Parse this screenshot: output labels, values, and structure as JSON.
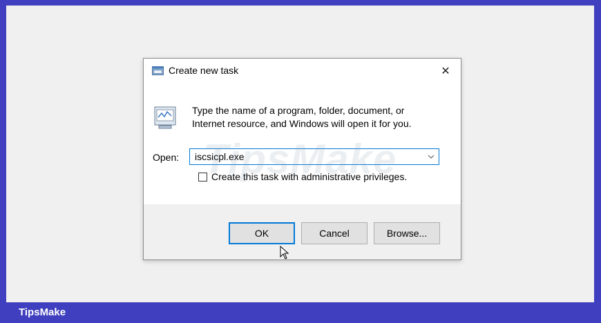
{
  "dialog": {
    "title": "Create new task",
    "close_glyph": "✕",
    "description_line1": "Type the name of a program, folder, document, or",
    "description_line2": "Internet resource, and Windows will open it for you.",
    "open_label": "Open:",
    "open_value": "iscsicpl.exe",
    "admin_checkbox_label": "Create this task with administrative privileges.",
    "admin_checked": false,
    "buttons": {
      "ok": "OK",
      "cancel": "Cancel",
      "browse": "Browse..."
    },
    "icons": {
      "title": "run-window-icon",
      "body": "run-program-icon",
      "dropdown": "chevron-down-icon"
    }
  },
  "footer": {
    "brand": "TipsMake"
  },
  "watermark": "TipsMake",
  "colors": {
    "frame": "#3f3fbf",
    "accent": "#0078d7",
    "button_bg": "#e1e1e1",
    "footer_text": "#ffffff"
  }
}
